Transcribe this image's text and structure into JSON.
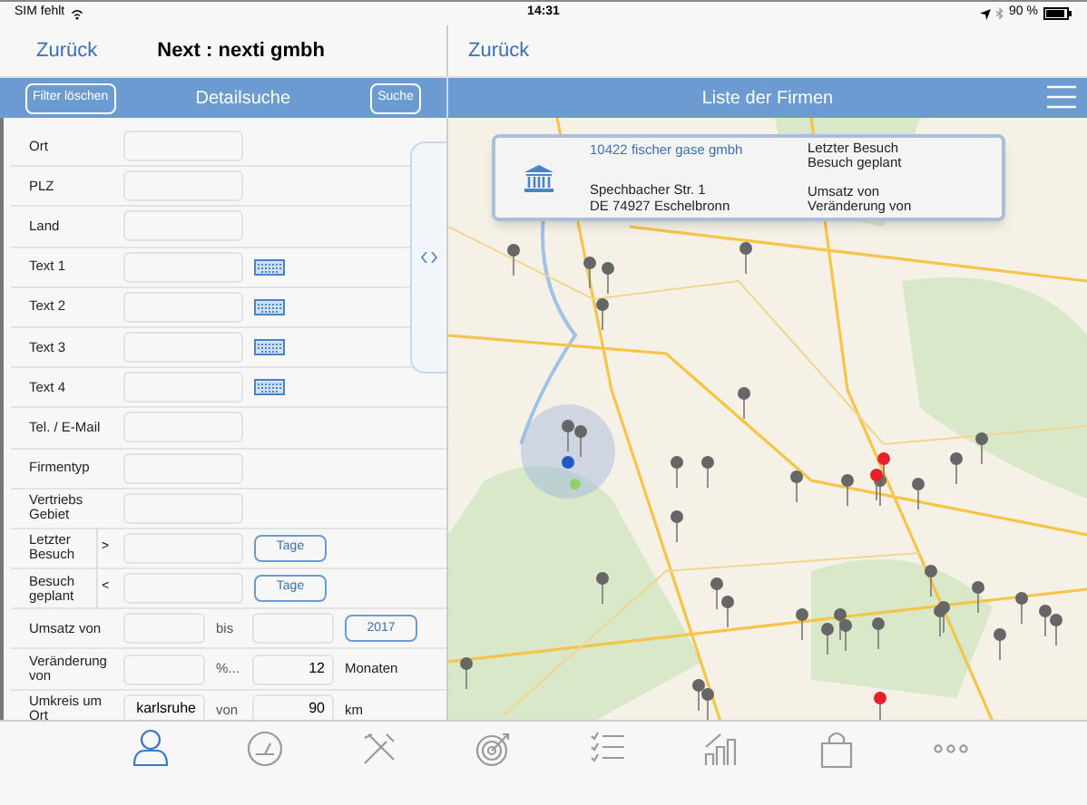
{
  "status_bar": {
    "carrier": "SIM fehlt",
    "time": "14:31",
    "battery": "90 %"
  },
  "left_nav": {
    "back": "Zurück",
    "title": "Next : nexti gmbh"
  },
  "right_nav": {
    "back": "Zurück"
  },
  "left_header": {
    "clear_button": "Filter löschen",
    "title": "Detailsuche",
    "search_button": "Suche"
  },
  "right_header": {
    "title": "Liste der Firmen"
  },
  "form_rows": [
    {
      "kind": "text",
      "label": "Ort"
    },
    {
      "kind": "text",
      "label": "PLZ"
    },
    {
      "kind": "text",
      "label": "Land"
    },
    {
      "kind": "keyboard",
      "label": "Text 1"
    },
    {
      "kind": "keyboard",
      "label": "Text 2"
    },
    {
      "kind": "keyboard",
      "label": "Text 3"
    },
    {
      "kind": "keyboard",
      "label": "Text 4"
    },
    {
      "kind": "text",
      "label": "Tel. / E-Mail"
    },
    {
      "kind": "text",
      "label": "Firmentyp"
    },
    {
      "kind": "text",
      "label": "Vertriebs Gebiet"
    },
    {
      "kind": "days",
      "label": "Letzter Besuch",
      "operator": ">",
      "button": "Tage"
    },
    {
      "kind": "days",
      "label": "Besuch geplant",
      "operator": "<",
      "button": "Tage"
    },
    {
      "kind": "range",
      "label": "Umsatz von",
      "middle": "bis",
      "button": "2017"
    },
    {
      "kind": "range",
      "label": "Veränderung von",
      "middle": "%...",
      "value2": "12",
      "unit": "Monaten"
    },
    {
      "kind": "range",
      "label": "Umkreis um Ort",
      "value1": "karlsruhe",
      "middle": "von",
      "value2": "90",
      "unit": "km"
    }
  ],
  "map_popup": {
    "company": "10422 fischer gase gmbh",
    "address_lines": [
      "Spechbacher Str. 1",
      "DE 74927 Eschelbronn"
    ],
    "info_lines": [
      "Letzter Besuch",
      "Besuch geplant",
      "Umsatz von",
      "Veränderung von"
    ]
  },
  "tab_bar": [
    {
      "kind": "person",
      "selected": true
    },
    {
      "kind": "gauge",
      "selected": false
    },
    {
      "kind": "tools",
      "selected": false
    },
    {
      "kind": "target",
      "selected": false
    },
    {
      "kind": "checklist",
      "selected": false
    },
    {
      "kind": "chart",
      "selected": false
    },
    {
      "kind": "bag",
      "selected": false
    },
    {
      "kind": "more",
      "selected": false
    }
  ]
}
